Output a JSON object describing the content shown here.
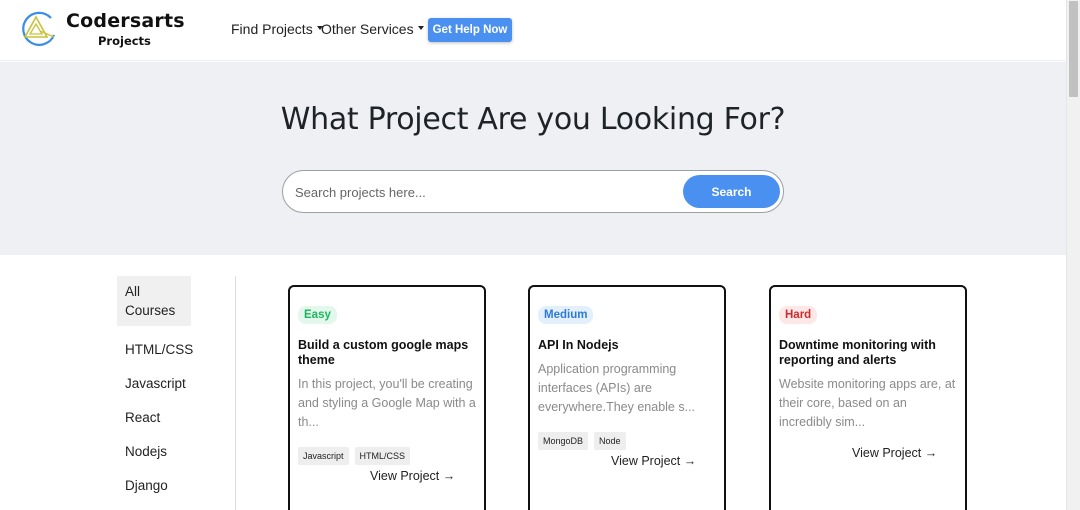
{
  "brand": {
    "name": "Codersarts",
    "sub": "Projects"
  },
  "nav": {
    "find_projects": "Find Projects",
    "other_services": "Other Services",
    "help_button": "Get Help Now"
  },
  "hero": {
    "title": "What Project Are you Looking For?",
    "search_placeholder": "Search projects here...",
    "search_button": "Search"
  },
  "sidebar": {
    "items": [
      "All Courses",
      "HTML/CSS",
      "Javascript",
      "React",
      "Nodejs",
      "Django"
    ]
  },
  "cards": [
    {
      "difficulty": "Easy",
      "title": "Build a custom google maps theme",
      "desc": "In this project, you'll be creating and styling a Google Map with a th...",
      "tags": [
        "Javascript",
        "HTML/CSS"
      ],
      "link": "View Project →"
    },
    {
      "difficulty": "Medium",
      "title": "API In Nodejs",
      "desc": "Application programming interfaces (APIs) are everywhere.They enable s...",
      "tags": [
        "MongoDB",
        "Node"
      ],
      "link": "View Project →"
    },
    {
      "difficulty": "Hard",
      "title": "Downtime monitoring with reporting and alerts",
      "desc": "Website monitoring apps are, at their core, based on an incredibly sim...",
      "tags": [],
      "link": "View Project →"
    }
  ],
  "colors": {
    "accent": "#4a90f0",
    "hero_bg": "#eef0f4",
    "easy": "#1ab85c",
    "medium": "#2c7ad6",
    "hard": "#d02b2b"
  },
  "icons": {
    "logo": "triangle-logo-icon",
    "dropdown": "caret-down-icon"
  }
}
